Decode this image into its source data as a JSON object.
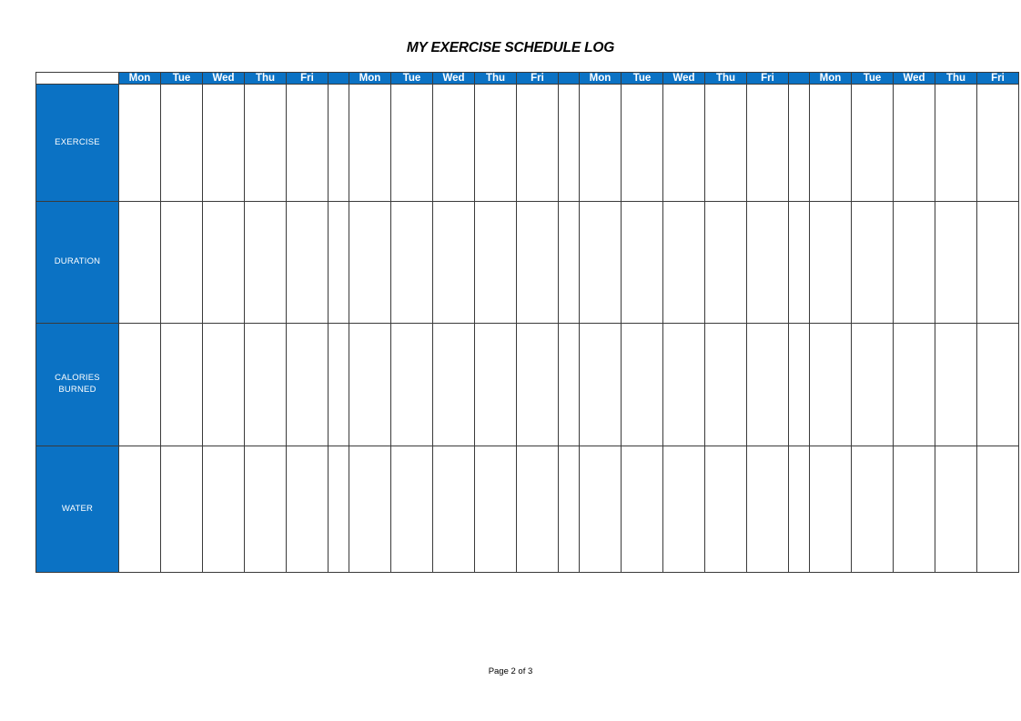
{
  "document": {
    "title": "MY EXERCISE SCHEDULE LOG",
    "footer": "Page 2 of 3"
  },
  "theme": {
    "header_blue": "#0b72c4",
    "header_text": "#ffffff",
    "grid_line": "#6f6f6f",
    "page_background": "#ffffff"
  },
  "table": {
    "corner_label": "",
    "weeks": [
      {
        "days": [
          "Mon",
          "Tue",
          "Wed",
          "Thu",
          "Fri"
        ]
      },
      {
        "days": [
          "Mon",
          "Tue",
          "Wed",
          "Thu",
          "Fri"
        ]
      },
      {
        "days": [
          "Mon",
          "Tue",
          "Wed",
          "Thu",
          "Fri"
        ]
      },
      {
        "days": [
          "Mon",
          "Tue",
          "Wed",
          "Thu",
          "Fri"
        ]
      }
    ],
    "rows": [
      {
        "label": "EXERCISE",
        "label_lines": [
          "EXERCISE"
        ]
      },
      {
        "label": "DURATION",
        "label_lines": [
          "DURATION"
        ]
      },
      {
        "label": "CALORIES BURNED",
        "label_lines": [
          "CALORIES",
          "BURNED"
        ]
      },
      {
        "label": "WATER",
        "label_lines": [
          "WATER"
        ]
      }
    ]
  }
}
